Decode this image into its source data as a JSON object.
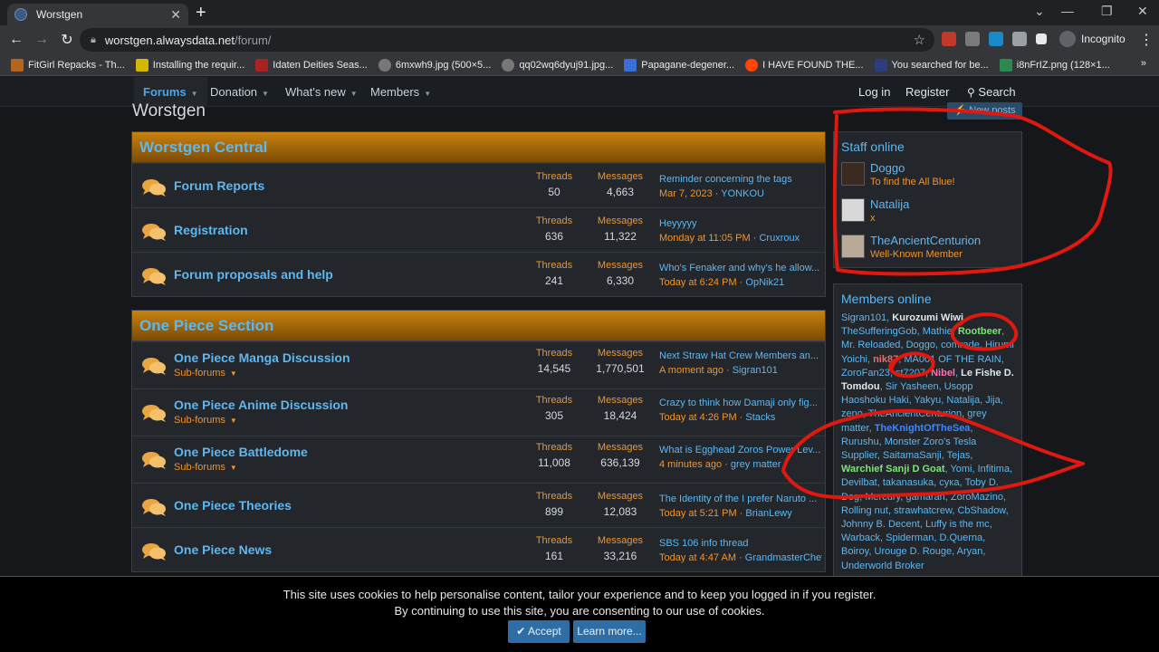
{
  "browser": {
    "tab_title": "Worstgen",
    "url_host": "worstgen.alwaysdata.net",
    "url_path": "/forum/",
    "profile_label": "Incognito",
    "bookmarks": [
      {
        "label": "FitGirl Repacks - Th...",
        "color": "#b5651d"
      },
      {
        "label": "Installing the requir...",
        "color": "#d4b800"
      },
      {
        "label": "Idaten Deities Seas...",
        "color": "#a22"
      },
      {
        "label": "6mxwh9.jpg (500×5...",
        "color": "#777"
      },
      {
        "label": "qq02wq6dyuj91.jpg...",
        "color": "#777"
      },
      {
        "label": "Papagane-degener...",
        "color": "#3b6fd8"
      },
      {
        "label": "I HAVE FOUND THE...",
        "color": "#ff4500"
      },
      {
        "label": "You searched for be...",
        "color": "#2b3d7a"
      },
      {
        "label": "i8nFrIZ.png (128×1...",
        "color": "#2d8a4e"
      }
    ]
  },
  "nav": {
    "forums": "Forums",
    "donation": "Donation",
    "whats_new": "What's new",
    "members": "Members",
    "login": "Log in",
    "register": "Register",
    "search": "Search"
  },
  "page": {
    "title": "Worstgen",
    "new_posts": "New posts"
  },
  "stat_labels": {
    "threads": "Threads",
    "messages": "Messages"
  },
  "sections": [
    {
      "title": "Worstgen Central",
      "nodes": [
        {
          "title": "Forum Reports",
          "sub": "",
          "threads": "50",
          "messages": "4,663",
          "latest_title": "Reminder concerning the tags",
          "latest_date": "Mar 7, 2023",
          "latest_user": "YONKOU"
        },
        {
          "title": "Registration",
          "sub": "",
          "threads": "636",
          "messages": "11,322",
          "latest_title": "Heyyyyy",
          "latest_date": "Monday at 11:05 PM",
          "latest_user": "Cruxroux"
        },
        {
          "title": "Forum proposals and help",
          "sub": "",
          "threads": "241",
          "messages": "6,330",
          "latest_title": "Who's Fenaker and why's he allow...",
          "latest_date": "Today at 6:24 PM",
          "latest_user": "OpNik21"
        }
      ]
    },
    {
      "title": "One Piece Section",
      "nodes": [
        {
          "title": "One Piece Manga Discussion",
          "sub": "Sub-forums",
          "threads": "14,545",
          "messages": "1,770,501",
          "latest_title": "Next Straw Hat Crew Members an...",
          "latest_date": "A moment ago",
          "latest_user": "Sigran101"
        },
        {
          "title": "One Piece Anime Discussion",
          "sub": "Sub-forums",
          "threads": "305",
          "messages": "18,424",
          "latest_title": "Crazy to think how Damaji only fig...",
          "latest_date": "Today at 4:26 PM",
          "latest_user": "Stacks"
        },
        {
          "title": "One Piece Battledome",
          "sub": "Sub-forums",
          "threads": "11,008",
          "messages": "636,139",
          "latest_title": "What is Egghead Zoros Power Lev...",
          "latest_date": "4 minutes ago",
          "latest_user": "grey matter"
        },
        {
          "title": "One Piece Theories",
          "sub": "",
          "threads": "899",
          "messages": "12,083",
          "latest_title": "The Identity of the I prefer Naruto ...",
          "latest_date": "Today at 5:21 PM",
          "latest_user": "BrianLewy"
        },
        {
          "title": "One Piece News",
          "sub": "",
          "threads": "161",
          "messages": "33,216",
          "latest_title": "SBS 106 info thread",
          "latest_date": "Today at 4:47 AM",
          "latest_user": "GrandmasterChef"
        }
      ]
    }
  ],
  "staff_online": {
    "heading": "Staff online",
    "members": [
      {
        "name": "Doggo",
        "title": "To find the All Blue!"
      },
      {
        "name": "Natalija",
        "title": "x"
      },
      {
        "name": "TheAncientCenturion",
        "title": "Well-Known Member"
      }
    ]
  },
  "members_online": {
    "heading": "Members online",
    "names": [
      {
        "n": "Sigran101",
        "s": ""
      },
      {
        "n": "Kurozumi Wiwi",
        "s": "b"
      },
      {
        "n": "TheSufferingGob",
        "s": ""
      },
      {
        "n": "Mathie",
        "s": ""
      },
      {
        "n": "Rootbeer",
        "s": "g"
      },
      {
        "n": "Mr. Reloaded",
        "s": ""
      },
      {
        "n": "Doggo",
        "s": ""
      },
      {
        "n": "comrade",
        "s": ""
      },
      {
        "n": "Hirumi Yoichi",
        "s": ""
      },
      {
        "n": "nik87",
        "s": "r"
      },
      {
        "n": "MA001 OF THE RAIN",
        "s": ""
      },
      {
        "n": "ZoroFan23",
        "s": ""
      },
      {
        "n": "st7207",
        "s": ""
      },
      {
        "n": "Nibel",
        "s": "p"
      },
      {
        "n": "Le Fishe D. Tomdou",
        "s": "b"
      },
      {
        "n": "Sir Yasheen",
        "s": ""
      },
      {
        "n": "Usopp Haoshoku Haki",
        "s": ""
      },
      {
        "n": "Yakyu",
        "s": ""
      },
      {
        "n": "Natalija",
        "s": ""
      },
      {
        "n": "Jija",
        "s": ""
      },
      {
        "n": "zeno",
        "s": ""
      },
      {
        "n": "TheAncientCenturion",
        "s": ""
      },
      {
        "n": "grey matter",
        "s": ""
      },
      {
        "n": "TheKnightOfTheSea",
        "s": "bl"
      },
      {
        "n": "Rurushu",
        "s": ""
      },
      {
        "n": "Monster Zoro's Tesla Supplier",
        "s": ""
      },
      {
        "n": "SaitamaSanji",
        "s": ""
      },
      {
        "n": "Tejas",
        "s": ""
      },
      {
        "n": "Warchief Sanji D Goat",
        "s": "g"
      },
      {
        "n": "Yomi",
        "s": ""
      },
      {
        "n": "Infitima",
        "s": ""
      },
      {
        "n": "Devilbat",
        "s": ""
      },
      {
        "n": "takanasuka",
        "s": ""
      },
      {
        "n": "сука",
        "s": ""
      },
      {
        "n": "Toby D. Dog",
        "s": ""
      },
      {
        "n": "Mercury",
        "s": ""
      },
      {
        "n": "gamaran",
        "s": ""
      },
      {
        "n": "ZoroMazino",
        "s": ""
      },
      {
        "n": "Rolling nut",
        "s": ""
      },
      {
        "n": "strawhatcrew",
        "s": ""
      },
      {
        "n": "CbShadow",
        "s": ""
      },
      {
        "n": "Johnny B. Decent",
        "s": ""
      },
      {
        "n": "Luffy is the mc",
        "s": ""
      },
      {
        "n": "Warback",
        "s": ""
      },
      {
        "n": "Spiderman",
        "s": ""
      },
      {
        "n": "D.Querna",
        "s": ""
      },
      {
        "n": "Boiroy",
        "s": ""
      },
      {
        "n": "Urouge D. Rouge",
        "s": ""
      },
      {
        "n": "Aryan",
        "s": ""
      },
      {
        "n": "Underworld Broker",
        "s": ""
      }
    ]
  },
  "cookie": {
    "line1": "This site uses cookies to help personalise content, tailor your experience and to keep you logged in if you register.",
    "line2": "By continuing to use this site, you are consenting to our use of cookies.",
    "accept": "Accept",
    "learn_more": "Learn more..."
  },
  "colors": {
    "link": "#5eb7f0",
    "accent_orange": "#f0942e",
    "annotation_red": "#e0180f",
    "header_gradient_top": "#c9820f"
  }
}
